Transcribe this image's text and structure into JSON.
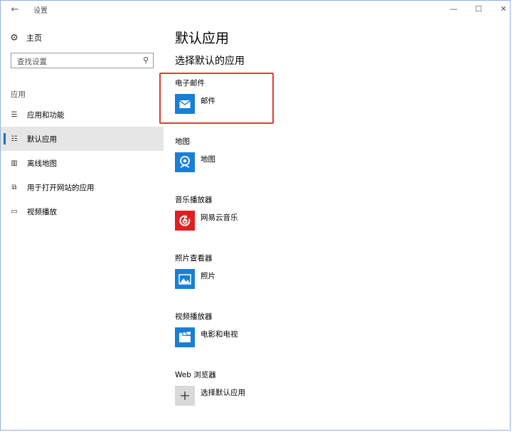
{
  "window": {
    "title": "设置",
    "back_glyph": "←",
    "minimize_glyph": "—",
    "maximize_glyph": "☐",
    "close_glyph": "✕"
  },
  "sidebar": {
    "home_label": "主页",
    "search_placeholder": "查找设置",
    "section_label": "应用",
    "items": [
      {
        "label": "应用和功能",
        "icon": "list-icon",
        "glyph": "☰",
        "selected": false
      },
      {
        "label": "默认应用",
        "icon": "default-apps-icon",
        "glyph": "☷",
        "selected": true
      },
      {
        "label": "离线地图",
        "icon": "map-icon",
        "glyph": "▥",
        "selected": false
      },
      {
        "label": "用于打开网站的应用",
        "icon": "website-apps-icon",
        "glyph": "⧉",
        "selected": false
      },
      {
        "label": "视频播放",
        "icon": "video-icon",
        "glyph": "▭",
        "selected": false
      }
    ]
  },
  "main": {
    "title": "默认应用",
    "subtitle": "选择默认的应用",
    "categories": [
      {
        "label": "电子邮件",
        "app": "邮件",
        "icon": "mail-icon"
      },
      {
        "label": "地图",
        "app": "地图",
        "icon": "maps-app-icon"
      },
      {
        "label": "音乐播放器",
        "app": "网易云音乐",
        "icon": "netease-music-icon"
      },
      {
        "label": "照片查看器",
        "app": "照片",
        "icon": "photos-icon"
      },
      {
        "label": "视频播放器",
        "app": "电影和电视",
        "icon": "movies-tv-icon"
      },
      {
        "label": "Web 浏览器",
        "app": "选择默认应用",
        "icon": "plus-icon"
      }
    ]
  },
  "colors": {
    "accent": "#1a7fd4",
    "selection_bar": "#1a6fc2",
    "highlight_box": "#e53935",
    "music_red": "#e02020"
  }
}
